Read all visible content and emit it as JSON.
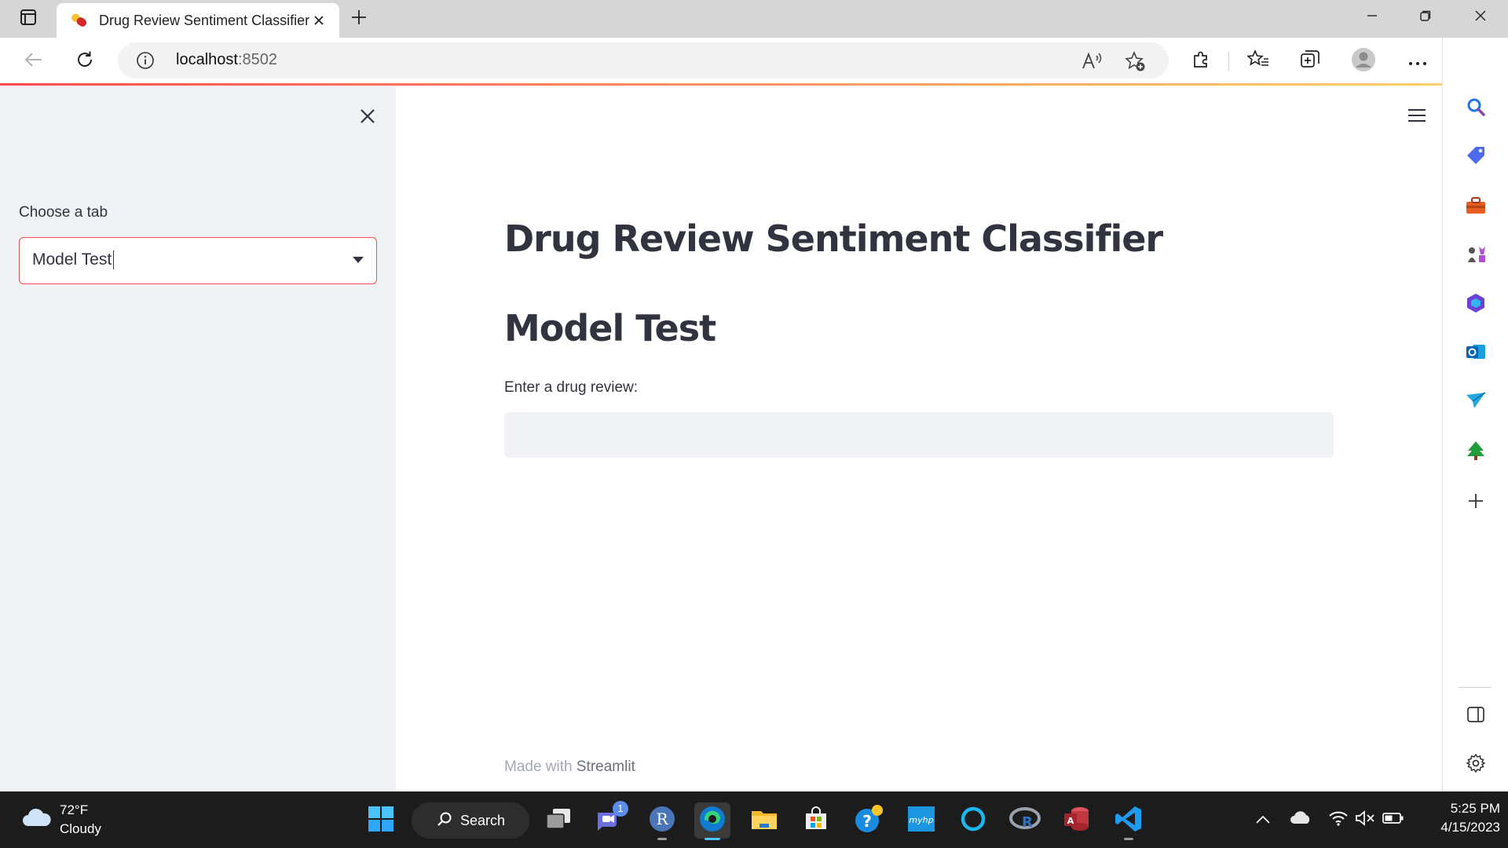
{
  "browser": {
    "tab": {
      "title": "Drug Review Sentiment Classifier"
    },
    "address": {
      "host": "localhost",
      "port": ":8502"
    }
  },
  "sidebar": {
    "select_label": "Choose a tab",
    "select_value": "Model Test"
  },
  "main": {
    "title": "Drug Review Sentiment Classifier",
    "section": "Model Test",
    "input_label": "Enter a drug review:",
    "input_value": "",
    "footer_prefix": "Made with ",
    "footer_brand": "Streamlit"
  },
  "taskbar": {
    "weather_temp": "72°F",
    "weather_condition": "Cloudy",
    "search_label": "Search",
    "teams_badge": "1",
    "time": "5:25 PM",
    "date": "4/15/2023"
  },
  "colors": {
    "streamlit_red": "#ff4b4b",
    "sidebar_bg": "#f0f2f6",
    "text": "#31333f",
    "taskbar_bg": "#1c1c1c"
  }
}
